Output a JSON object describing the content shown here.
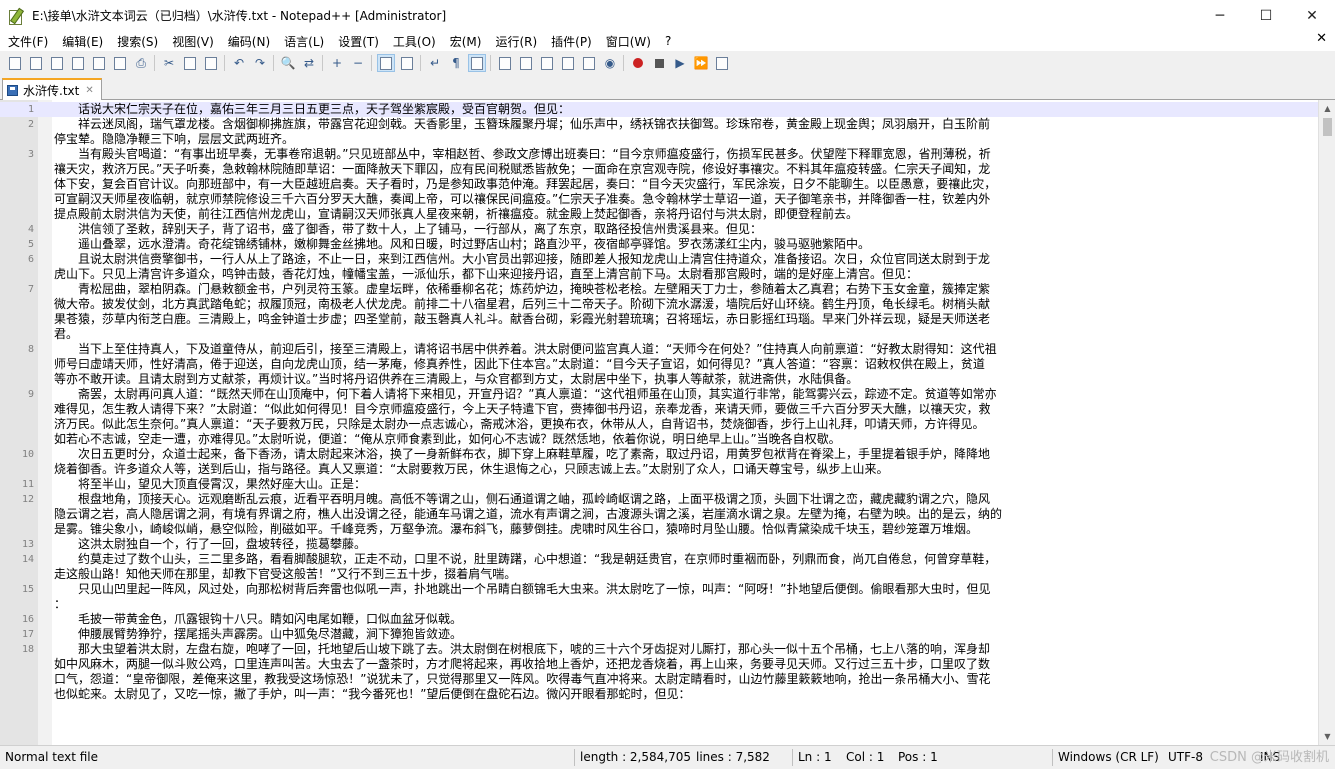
{
  "window": {
    "title": "E:\\接单\\水浒文本词云（已归档）\\水浒传.txt - Notepad++ [Administrator]",
    "minimize": "─",
    "maximize": "☐",
    "close": "✕"
  },
  "menu": {
    "items": [
      "文件(F)",
      "编辑(E)",
      "搜索(S)",
      "视图(V)",
      "编码(N)",
      "语言(L)",
      "设置(T)",
      "工具(O)",
      "宏(M)",
      "运行(R)",
      "插件(P)",
      "窗口(W)",
      "?"
    ],
    "close": "✕"
  },
  "toolbar": {
    "icons": [
      "new-file-icon",
      "open-file-icon",
      "save-icon",
      "save-all-icon",
      "close-icon",
      "close-all-icon",
      "print-icon",
      "cut-icon",
      "copy-icon",
      "paste-icon",
      "undo-icon",
      "redo-icon",
      "find-icon",
      "replace-icon",
      "zoom-in-icon",
      "zoom-out-icon",
      "sync-vertical-icon",
      "sync-horizontal-icon",
      "word-wrap-icon",
      "show-all-chars-icon",
      "indent-guide-icon",
      "udl-icon",
      "doc-map-icon",
      "function-list-icon",
      "folder-workspace-icon",
      "doc-list-icon",
      "monitoring-icon",
      "record-macro-icon",
      "stop-macro-icon",
      "play-macro-icon",
      "run-macro-multiple-icon",
      "save-macro-icon"
    ]
  },
  "tab": {
    "label": "水浒传.txt",
    "close": "✕"
  },
  "editor": {
    "lines": [
      {
        "n": "1",
        "t": "　　话说大宋仁宗天子在位，嘉佑三年三月三日五更三点，天子驾坐紫宸殿，受百官朝贺。但见："
      },
      {
        "n": "2",
        "t": "　　祥云迷凤阁，瑞气罩龙楼。含烟御柳拂旌旗，带露宫花迎剑戟。天香影里，玉簪珠履聚丹墀；仙乐声中，绣袄锦衣扶御驾。珍珠帘卷，黄金殿上现金舆；凤羽扇开，白玉阶前"
      },
      {
        "n": "",
        "t": "停宝辇。隐隐净鞭三下响，层层文武两班齐。"
      },
      {
        "n": "3",
        "t": "　　当有殿头官喝道：“有事出班早奏，无事卷帘退朝。”只见班部丛中，宰相赵哲、参政文彦博出班奏曰：“目今京师瘟疫盛行，伤损军民甚多。伏望陛下释罪宽恩，省刑薄税，祈"
      },
      {
        "n": "",
        "t": "禳天灾，救济万民。”天子听奏，急敕翰林院随即草诏：一面降赦天下罪囚，应有民间税赋悉皆赦免；一面命在京宫观寺院，修设好事禳灾。不料其年瘟疫转盛。仁宗天子闻知，龙"
      },
      {
        "n": "",
        "t": "体下安，复会百官计议。向那班部中，有一大臣越班启奏。天子看时，乃是参知政事范仲淹。拜罢起居，奏曰：“目今天灾盛行，军民涂炭，日夕不能聊生。以臣愚意，要禳此灾，"
      },
      {
        "n": "",
        "t": "可宣嗣汉天师星夜临朝，就京师禁院修设三千六百分罗天大醮，奏闻上帝，可以禳保民间瘟疫。”仁宗天子准奏。急令翰林学士草诏一道，天子御笔亲书，并降御香一柱，钦差内外"
      },
      {
        "n": "",
        "t": "提点殿前太尉洪信为天使，前往江西信州龙虎山，宣请嗣汉天师张真人星夜来朝，祈禳瘟疫。就金殿上焚起御香，亲将丹诏付与洪太尉，即便登程前去。"
      },
      {
        "n": "4",
        "t": "　　洪信领了圣敕，辞别天子，背了诏书，盛了御香，带了数十人，上了铺马，一行部从，离了东京，取路径投信州贵溪县来。但见："
      },
      {
        "n": "5",
        "t": "　　遥山叠翠，远水澄清。奇花绽锦绣铺林，嫩柳舞金丝拂地。风和日暖，时过野店山村；路直沙平，夜宿邮亭驿馆。罗衣荡漾红尘内，骏马驱驰紫陌中。"
      },
      {
        "n": "6",
        "t": "　　且说太尉洪信赍擎御书，一行人从上了路途，不止一日，来到江西信州。大小官员出郭迎接，随即差人报知龙虎山上清宫住持道众，准备接诏。次日，众位官同送太尉到于龙"
      },
      {
        "n": "",
        "t": "虎山下。只见上清宫许多道众，鸣钟击鼓，香花灯烛，幢幡宝盖，一派仙乐，都下山来迎接丹诏，直至上清宫前下马。太尉看那宫殿时，端的是好座上清宫。但见："
      },
      {
        "n": "7",
        "t": "　　青松屈曲，翠柏阴森。门悬敕额金书，户列灵符玉篆。虚皇坛畔，依稀垂柳名花；炼药炉边，掩映苍松老桧。左壁厢天丁力士，参随着太乙真君；右势下玉女金童，簇捧定紫"
      },
      {
        "n": "",
        "t": "微大帝。披发仗剑，北方真武踏龟蛇；叔履顶冠，南极老人伏龙虎。前排二十八宿星君，后列三十二帝天子。阶砌下流水潺湲，墙院后好山环绕。鹤生丹顶，龟长绿毛。树梢头献"
      },
      {
        "n": "",
        "t": "果苍猿，莎草内衔芝白鹿。三清殿上，鸣金钟道士步虚；四圣堂前，敲玉磬真人礼斗。献香台砌，彩霞光射碧琉璃；召将瑶坛，赤日影摇红玛瑙。早来门外祥云现，疑是天师送老"
      },
      {
        "n": "",
        "t": "君。"
      },
      {
        "n": "8",
        "t": "　　当下上至住持真人，下及道童侍从，前迎后引，接至三清殿上，请将诏书居中供养着。洪太尉便问监宫真人道：“天师今在何处？”住持真人向前禀道：“好教太尉得知：这代祖"
      },
      {
        "n": "",
        "t": "师号曰虚靖天师，性好清高，倦于迎送，自向龙虎山顶，结一茅庵，修真养性，因此下住本宫。”太尉道：“目今天子宣诏，如何得见？”真人答道：“容禀：诏敕权供在殿上，贫道"
      },
      {
        "n": "",
        "t": "等亦不敢开读。且请太尉到方丈献茶，再烦计议。”当时将丹诏供养在三清殿上，与众官都到方丈，太尉居中坐下，执事人等献茶，就进斋供，水陆俱备。"
      },
      {
        "n": "9",
        "t": "　　斋罢，太尉再问真人道：“既然天师在山顶庵中，何下着人请将下来相见，开宣丹诏？”真人禀道：“这代祖师虽在山顶，其实道行非常，能驾雾兴云，踪迹不定。贫道等如常亦"
      },
      {
        "n": "",
        "t": "难得见，怎生教人请得下来？”太尉道：“似此如何得见！目今京师瘟疫盛行，今上天子特遣下官，赍捧御书丹诏，亲奉龙香，来请天师，要做三千六百分罗天大醮，以禳天灾，救"
      },
      {
        "n": "",
        "t": "济万民。似此怎生奈何。”真人禀道：“天子要救万民，只除是太尉办一点志诚心，斋戒沐浴，更换布衣，休带从人，自背诏书，焚烧御香，步行上山礼拜，叩请天师，方许得见。"
      },
      {
        "n": "",
        "t": "如若心不志诚，空走一遭，亦难得见。”太尉听说，便道：“俺从京师食素到此，如何心不志诚？既然恁地，依着你说，明日绝早上山。”当晚各自权歇。"
      },
      {
        "n": "10",
        "t": "　　次日五更时分，众道士起来，备下香汤，请太尉起来沐浴，换了一身新鲜布衣，脚下穿上麻鞋草履，吃了素斋，取过丹诏，用黄罗包袱背在脊梁上，手里提着银手炉，降降地"
      },
      {
        "n": "",
        "t": "烧着御香。许多道众人等，送到后山，指与路径。真人又禀道：“太尉要救万民，休生退悔之心，只顾志诚上去。”太尉别了众人，口诵天尊宝号，纵步上山来。"
      },
      {
        "n": "11",
        "t": "　　将至半山，望见大顶直侵霄汉，果然好座大山。正是："
      },
      {
        "n": "12",
        "t": "　　根盘地角，顶接天心。远观磨断乱云痕，近看平吞明月魄。高低不等谓之山，侧石通道谓之岫，孤岭崎岖谓之路，上面平极谓之顶，头圆下壮谓之峦，藏虎藏豹谓之穴，隐风"
      },
      {
        "n": "",
        "t": "隐云谓之岩，高人隐居谓之洞，有境有界谓之府，樵人出没谓之径，能通车马谓之道，流水有声谓之涧，古渡源头谓之溪，岩崖滴水谓之泉。左壁为掩，右壁为映。出的是云，纳的"
      },
      {
        "n": "",
        "t": "是雾。锥尖象小，崎峻似峭，悬空似险，削磁如平。千峰竞秀，万壑争流。瀑布斜飞，藤萝倒挂。虎啸时风生谷口，猿啼时月坠山腰。恰似青黛染成千块玉，碧纱笼罩万堆烟。"
      },
      {
        "n": "13",
        "t": "　　这洪太尉独自一个，行了一回，盘坡转径，揽葛攀藤。"
      },
      {
        "n": "14",
        "t": "　　约莫走过了数个山头，三二里多路，看看脚酸腿软，正走不动，口里不说，肚里踌躇，心中想道：“我是朝廷贵官，在京师时重裀而卧，列鼎而食，尚兀自倦怠，何曾穿草鞋，"
      },
      {
        "n": "",
        "t": "走这般山路！知他天师在那里，却教下官受这般苦！”又行不到三五十步，掇着肩气喘。"
      },
      {
        "n": "15",
        "t": "　　只见山凹里起一阵风，风过处，向那松树背后奔雷也似吼一声，扑地跳出一个吊睛白额锦毛大虫来。洪太尉吃了一惊，叫声：“阿呀！”扑地望后便倒。偷眼看那大虫时，但见"
      },
      {
        "n": "",
        "t": "："
      },
      {
        "n": "16",
        "t": "　　毛披一带黄金色，爪露银钩十八只。睛如闪电尾如鞭，口似血盆牙似戟。"
      },
      {
        "n": "17",
        "t": "　　伸腰展臂势狰狞，摆尾摇头声霹雳。山中狐兔尽潜藏，涧下獐狍皆敛迹。"
      },
      {
        "n": "18",
        "t": "　　那大虫望着洪太尉，左盘右旋，咆哮了一回，托地望后山坡下跳了去。洪太尉倒在树根底下，唬的三十六个牙齿捉对儿厮打，那心头一似十五个吊桶，七上八落的响，浑身却"
      },
      {
        "n": "",
        "t": "如中风麻木，两腿一似斗败公鸡，口里连声叫苦。大虫去了一盏茶时，方才爬将起来，再收拾地上香炉，还把龙香烧着，再上山来，务要寻见天师。又行过三五十步，口里叹了数"
      },
      {
        "n": "",
        "t": "口气，怨道：“皇帝御限，差俺来这里，教我受这场惊恐！”说犹未了，只觉得那里又一阵风。吹得毒气直冲将来。太尉定睛看时，山边竹藤里簌簌地响，抢出一条吊桶大小、雪花"
      },
      {
        "n": "",
        "t": "也似蛇来。太尉见了，又吃一惊，撇了手炉，叫一声：“我今番死也！”望后便倒在盘砣石边。微闪开眼看那蛇时，但见："
      }
    ]
  },
  "status": {
    "file_type": "Normal text file",
    "length": "length : 2,584,705",
    "lines": "lines : 7,582",
    "ln": "Ln : 1",
    "col": "Col : 1",
    "pos": "Pos : 1",
    "eol": "Windows (CR LF)",
    "encoding": "UTF-8",
    "ins": "INS",
    "watermark": "CSDN @米码收割机"
  }
}
